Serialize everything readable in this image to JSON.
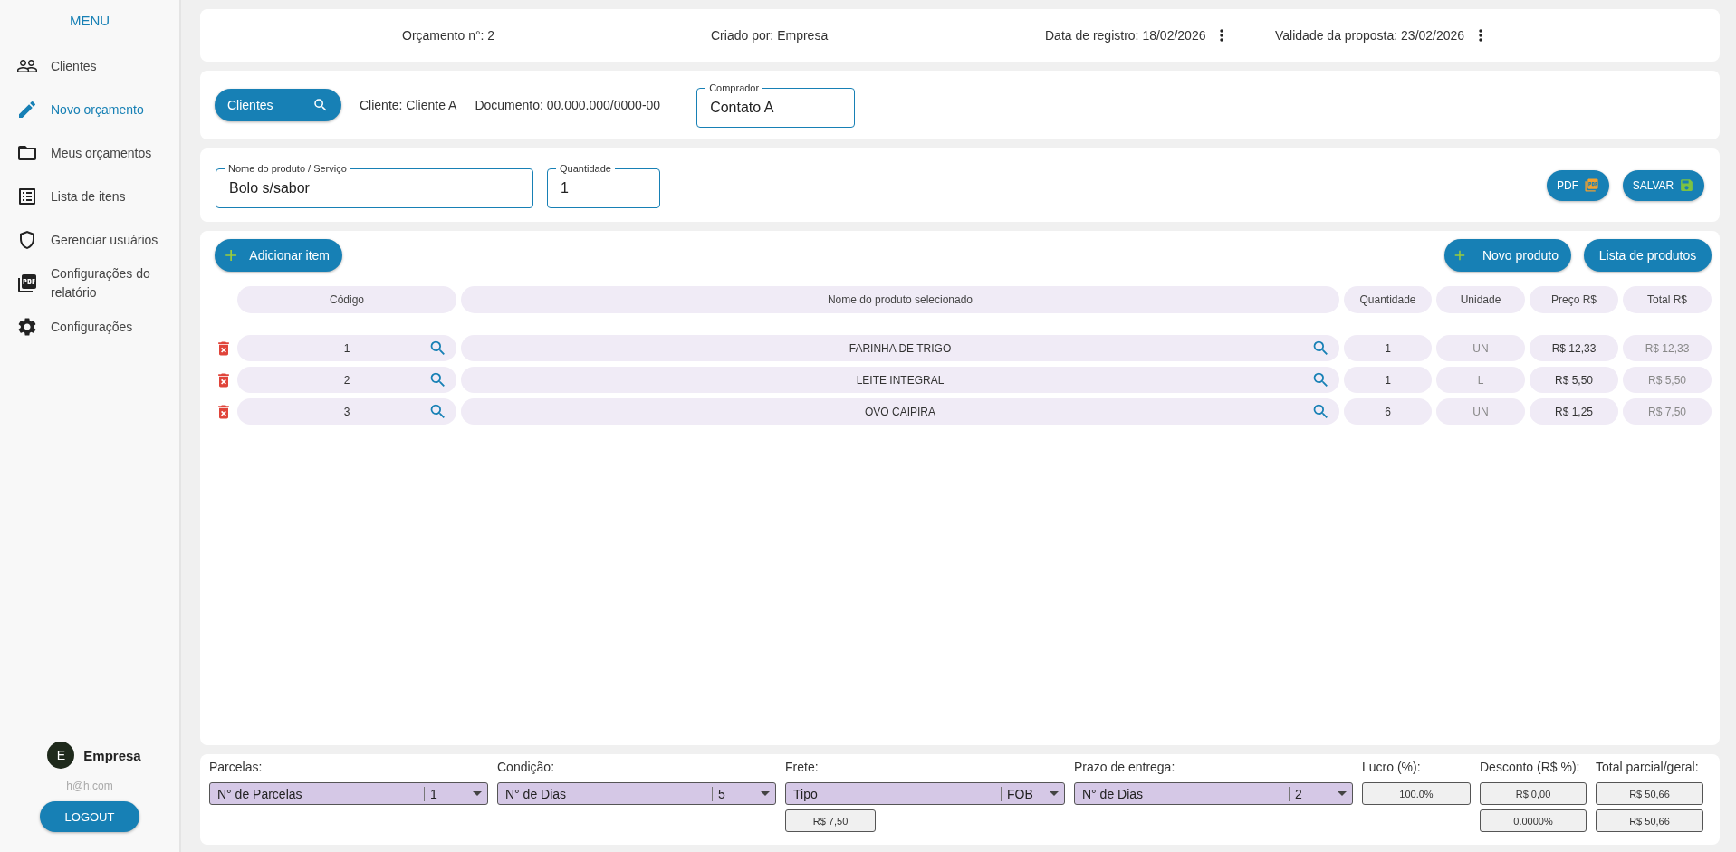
{
  "sidebar": {
    "title": "MENU",
    "items": [
      {
        "label": "Clientes",
        "selected": false
      },
      {
        "label": "Novo orçamento",
        "selected": true
      },
      {
        "label": "Meus orçamentos",
        "selected": false
      },
      {
        "label": "Lista de itens",
        "selected": false
      },
      {
        "label": "Gerenciar usuários",
        "selected": false
      },
      {
        "label": "Configurações do relatório",
        "selected": false
      },
      {
        "label": "Configurações",
        "selected": false
      }
    ],
    "user": {
      "initial": "E",
      "name": "Empresa",
      "email": "h@h.com"
    },
    "logout": "LOGOUT"
  },
  "header": [
    {
      "text": "Orçamento n°: 2",
      "has_menu": false
    },
    {
      "text": "Criado por: Empresa",
      "has_menu": false
    },
    {
      "text": "Data de registro: 18/02/2026",
      "has_menu": true
    },
    {
      "text": "Validade da proposta: 23/02/2026",
      "has_menu": true
    }
  ],
  "client": {
    "button": "Clientes",
    "client": "Cliente: Cliente A",
    "document": "Documento: 00.000.000/0000-00",
    "buyer": {
      "label": "Comprador",
      "value": "Contato A"
    }
  },
  "product": {
    "name": {
      "label": "Nome do produto / Serviço",
      "value": "Bolo s/sabor"
    },
    "quantity": {
      "label": "Quantidade",
      "value": "1"
    },
    "pdf": "PDF",
    "save": "SALVAR"
  },
  "items": {
    "add": "Adicionar item",
    "new_product": "Novo produto",
    "product_list": "Lista de produtos",
    "columns": [
      "Código",
      "Nome do produto selecionado",
      "Quantidade",
      "Unidade",
      "Preço R$",
      "Total R$"
    ],
    "rows": [
      [
        "1",
        "FARINHA DE TRIGO",
        "1",
        "UN",
        "R$ 12,33",
        "R$ 12,33"
      ],
      [
        "2",
        "LEITE INTEGRAL",
        "1",
        "L",
        "R$ 5,50",
        "R$ 5,50"
      ],
      [
        "3",
        "OVO CAIPIRA",
        "6",
        "UN",
        "R$ 1,25",
        "R$ 7,50"
      ]
    ]
  },
  "footer": [
    {
      "label": "Parcelas:",
      "kind": "select",
      "text": "N° de Parcelas",
      "value": "1"
    },
    {
      "label": "Condição:",
      "kind": "select",
      "text": "N° de Dias",
      "value": "5"
    },
    {
      "label": "Frete:",
      "kind": "select",
      "text": "Tipo",
      "value": "FOB",
      "boxes": [
        "R$ 7,50"
      ]
    },
    {
      "label": "Prazo de entrega:",
      "kind": "select",
      "text": "N° de Dias",
      "value": "2"
    },
    {
      "label": "Lucro (%):",
      "kind": "boxes",
      "boxes": [
        "100.0%"
      ]
    },
    {
      "label": "Desconto (R$ %):",
      "kind": "boxes",
      "boxes": [
        "R$ 0,00",
        "0.0000%"
      ]
    },
    {
      "label": "Total parcial/geral:",
      "kind": "boxes",
      "boxes": [
        "R$ 50,66",
        "R$ 50,66"
      ]
    }
  ]
}
